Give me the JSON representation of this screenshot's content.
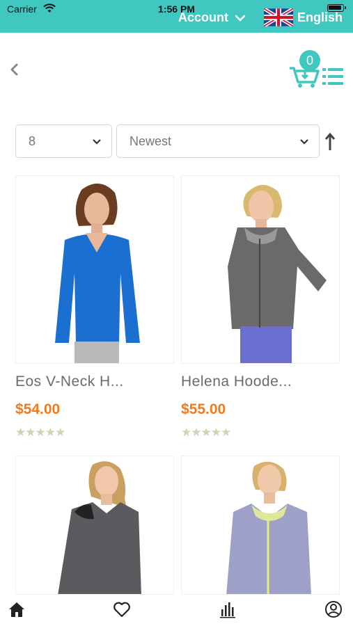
{
  "status": {
    "carrier": "Carrier",
    "time": "1:56 PM"
  },
  "topbar": {
    "account_label": "Account",
    "language_label": "English"
  },
  "header": {
    "cart_count": "0"
  },
  "filters": {
    "count_value": "8",
    "sort_value": "Newest"
  },
  "products": [
    {
      "name": "Eos V-Neck H...",
      "price": "$54.00",
      "stars": "★★★★★"
    },
    {
      "name": "Helena Hoode...",
      "price": "$55.00",
      "stars": "★★★★★"
    },
    {
      "name": "",
      "price": "",
      "stars": ""
    },
    {
      "name": "",
      "price": "",
      "stars": ""
    }
  ],
  "colors": {
    "accent": "#3fc7c0",
    "price": "#f07a1c"
  },
  "icons": [
    "wifi-icon",
    "battery-icon",
    "chevron-down-icon",
    "uk-flag-icon",
    "back-icon",
    "cart-icon",
    "list-view-icon",
    "sort-direction-icon",
    "home-icon",
    "heart-icon",
    "chart-icon",
    "user-icon"
  ]
}
